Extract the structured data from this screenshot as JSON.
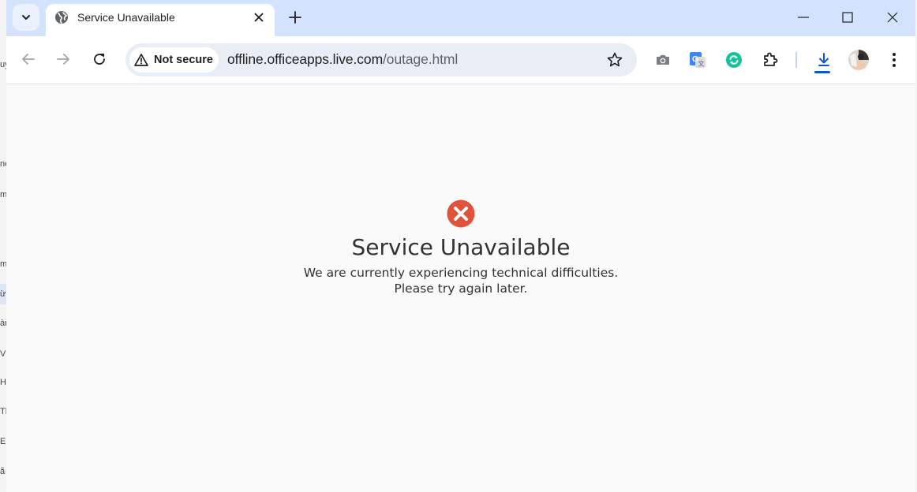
{
  "tab": {
    "title": "Service Unavailable"
  },
  "address_bar": {
    "security_label": "Not secure",
    "url_host": "offline.officeapps.live.com",
    "url_path": "/outage.html"
  },
  "icons": {
    "favicon": "globe-icon",
    "security": "warning-triangle-icon",
    "error": "error-x-icon",
    "extensions": [
      "camera-icon",
      "google-translate-icon",
      "grammarly-icon",
      "puzzle-icon",
      "download-icon"
    ]
  },
  "colors": {
    "tab_strip": "#d3e3fd",
    "error_red": "#e0533a",
    "download_accent": "#0b57d0"
  },
  "page": {
    "heading": "Service Unavailable",
    "line1": "We are currently experiencing technical difficulties.",
    "line2": "Please try again later."
  },
  "background_window": {
    "fragments": [
      "uy",
      "ne",
      "m",
      "m",
      "ừ",
      "àn",
      "V",
      "H",
      "Th",
      "E",
      "ã"
    ]
  }
}
